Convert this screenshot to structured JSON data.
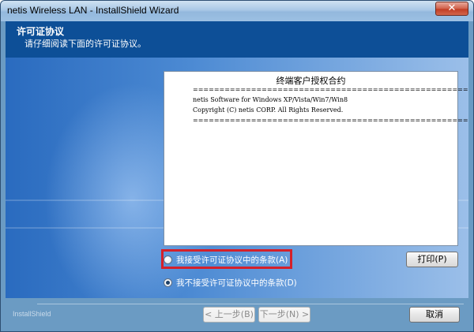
{
  "window": {
    "title": "netis Wireless LAN - InstallShield Wizard",
    "close_glyph": "✕"
  },
  "header": {
    "title": "许可证协议",
    "subtitle": "请仔细阅读下面的许可证协议。"
  },
  "license": {
    "title": "终端客户授权合约",
    "lines": [
      "====================================================",
      "netis Software for Windows XP/Vista/Win7/Win8",
      "Copyright (C) netis CORP. All Rights Reserved.",
      "===================================================="
    ]
  },
  "options": {
    "accept_label": "我接受许可证协议中的条款(A)",
    "decline_label": "我不接受许可证协议中的条款(D)",
    "selected": "decline"
  },
  "buttons": {
    "print": "打印(P)",
    "back": "< 上一步(B)",
    "next": "下一步(N) >",
    "cancel": "取消"
  },
  "footer": {
    "brand": "InstallShield"
  },
  "colors": {
    "header_bg": "#0d4f97",
    "highlight_border": "#d5202a",
    "close_button": "#c13d24"
  }
}
